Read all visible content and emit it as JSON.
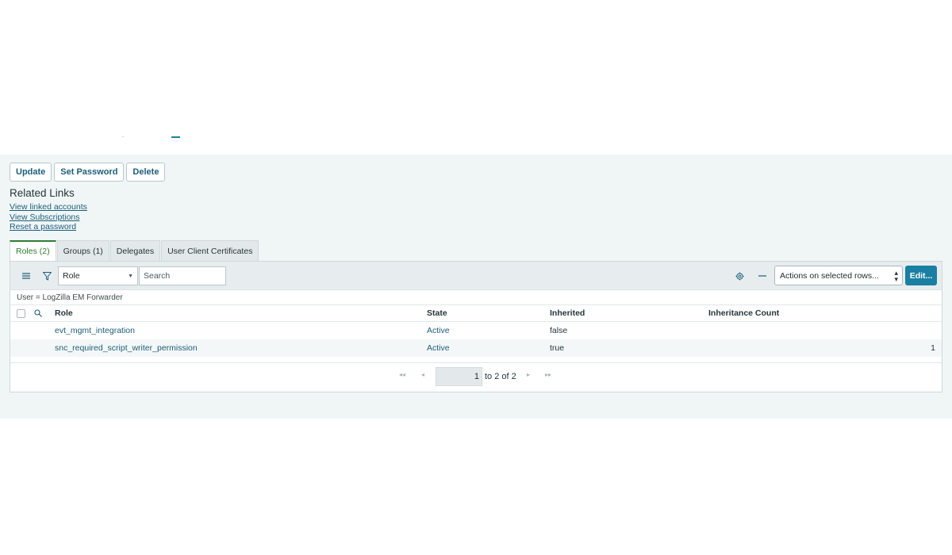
{
  "form": {
    "buttons": {
      "update": "Update",
      "set_password": "Set Password",
      "delete": "Delete"
    }
  },
  "related": {
    "title": "Related Links",
    "links": [
      "View linked accounts",
      "View Subscriptions",
      "Reset a password"
    ]
  },
  "tabs": [
    {
      "label": "Roles (2)",
      "active": true
    },
    {
      "label": "Groups (1)",
      "active": false
    },
    {
      "label": "Delegates",
      "active": false
    },
    {
      "label": "User Client Certificates",
      "active": false
    }
  ],
  "toolbar": {
    "filter_field": "Role",
    "search_placeholder": "Search",
    "actions_label": "Actions on selected rows...",
    "edit_label": "Edit..."
  },
  "breadcrumb": "User = LogZilla EM Forwarder",
  "table": {
    "columns": [
      "Role",
      "State",
      "Inherited",
      "Inheritance Count"
    ],
    "rows": [
      {
        "role": "evt_mgmt_integration",
        "state": "Active",
        "inherited": "false",
        "count": ""
      },
      {
        "role": "snc_required_script_writer_permission",
        "state": "Active",
        "inherited": "true",
        "count": "1"
      }
    ]
  },
  "pagination": {
    "current": "1",
    "of_text": "to 2 of 2"
  },
  "colors": {
    "accent": "#1a7fa3",
    "link": "#1c5d7a",
    "active_tab": "#2e7d32",
    "background": "#f0f6f6"
  },
  "icons": {
    "list": "hamburger-icon",
    "filter": "funnel-icon",
    "search": "magnifier-icon",
    "settings": "gear-icon",
    "collapse": "minus-icon",
    "first": "double-chevron-left-icon",
    "prev": "chevron-left-icon",
    "next": "chevron-right-icon",
    "last": "double-chevron-right-icon"
  }
}
